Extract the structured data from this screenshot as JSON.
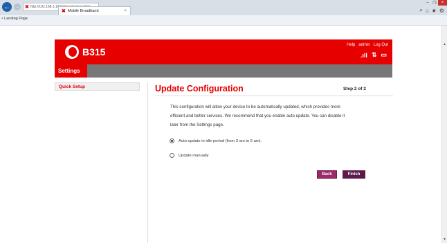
{
  "browser": {
    "address": "http://192.168.1.1/html/quicksetup.html",
    "tab_title": "Mobile Broadband",
    "tab_close": "×",
    "favorite": "Landing Page",
    "win_min": "–",
    "win_max": "❐",
    "win_close": "×",
    "search_icon": "⌕",
    "home_icon": "⌂",
    "star_icon": "★",
    "gear_icon": "⚙"
  },
  "header": {
    "model": "B315",
    "links": [
      "Help",
      "admin",
      "Log Out"
    ],
    "signal_icon": "signal-bars-icon",
    "signal_glyph": ".ıll",
    "transfer_glyph": "⇅",
    "wifi_glyph": "▭"
  },
  "menu": {
    "settings_label": "Settings"
  },
  "sidebar": {
    "quick_setup_label": "Quick Setup"
  },
  "main": {
    "title": "Update Configuration",
    "step": "Step 2 of 2",
    "description_lines": [
      "This configuration will allow your device to be automatically updated, which provides more",
      "efficient and better services. We recommend that you enable auto update. You can disable it",
      "later from the Settings page."
    ],
    "option_auto": "Auto-update in idle period (from 3 am to 5 am).",
    "option_manual": "Update manually",
    "selected_option": "auto",
    "back_label": "Back",
    "finish_label": "Finish"
  },
  "colors": {
    "brand_red": "#e60000",
    "menu_gray": "#777777",
    "button_purple": "#9c2a6b"
  }
}
